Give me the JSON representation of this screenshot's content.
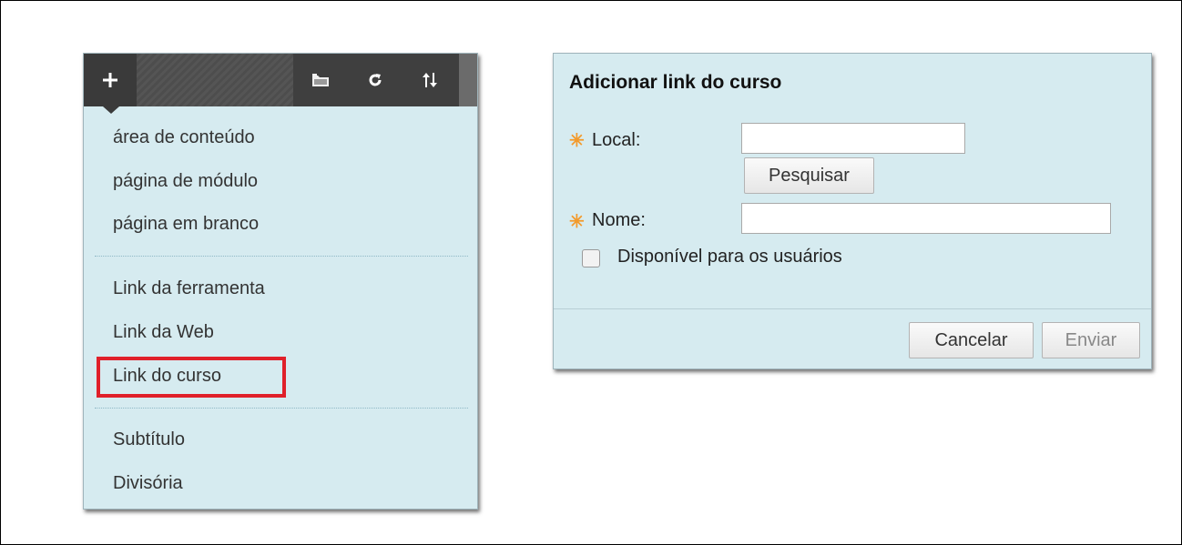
{
  "menu": {
    "toolbar": {
      "add_icon": "plus-icon",
      "folder_icon": "folder-icon",
      "refresh_icon": "refresh-icon",
      "sort_icon": "sort-icon"
    },
    "items": [
      {
        "label": "área de conteúdo"
      },
      {
        "label": "página de módulo"
      },
      {
        "label": "página em branco"
      },
      {
        "label": "Link da ferramenta"
      },
      {
        "label": "Link da Web"
      },
      {
        "label": "Link do curso"
      },
      {
        "label": "Subtítulo"
      },
      {
        "label": "Divisória"
      }
    ],
    "highlight_color": "#e0202a"
  },
  "dialog": {
    "title": "Adicionar link do curso",
    "local_label": "Local:",
    "local_value": "",
    "search_label": "Pesquisar",
    "name_label": "Nome:",
    "name_value": "",
    "available_label": "Disponível para os usuários",
    "available_checked": false,
    "cancel_label": "Cancelar",
    "submit_label": "Enviar",
    "required_color": "#f39a2b",
    "background_color": "#d6ebf0"
  }
}
